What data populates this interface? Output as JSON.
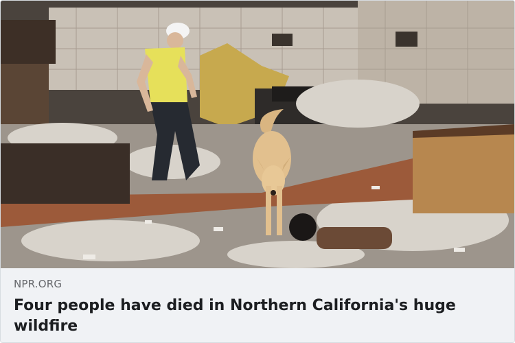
{
  "link_preview": {
    "image_description_icon": "photo-wildfire-ruins",
    "source_domain": "NPR.ORG",
    "headline": "Four people have died in Northern California's huge wildfire"
  },
  "colors": {
    "background": "#f0f2f5",
    "headline": "#1c1e21",
    "domain": "#65676b"
  }
}
